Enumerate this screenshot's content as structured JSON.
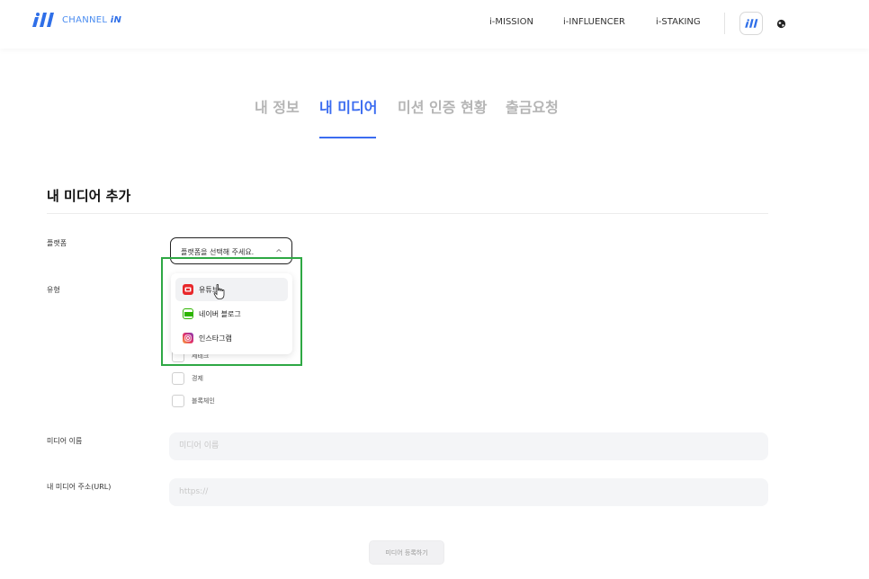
{
  "header": {
    "logo_text_prefix": "CHANNEL ",
    "logo_text_suffix": "iN",
    "nav": [
      "i-MISSION",
      "i-INFLUENCER",
      "i-STAKING"
    ],
    "wallet_icon": "logo-mark-icon",
    "globe_icon": "globe-icon"
  },
  "tabs": [
    {
      "label": "내 정보",
      "active": false
    },
    {
      "label": "내 미디어",
      "active": true
    },
    {
      "label": "미션 인증 현황",
      "active": false
    },
    {
      "label": "출금요청",
      "active": false
    }
  ],
  "section": {
    "title": "내 미디어 추가"
  },
  "form": {
    "platform_label": "플랫폼",
    "platform_placeholder": "플랫폼을 선택해 주세요.",
    "type_label": "유형",
    "type_options": [
      "세테크",
      "경제",
      "블록체인"
    ],
    "media_name_label": "미디어 이름",
    "media_name_placeholder": "미디어 이름",
    "url_label": "내 미디어 주소(URL)",
    "url_placeholder": "https://",
    "submit_label": "미디어 등록하기"
  },
  "dropdown": {
    "items": [
      {
        "label": "유튜브",
        "icon": "youtube-icon",
        "color": "#e8282b"
      },
      {
        "label": "네이버 블로그",
        "icon": "naver-blog-icon",
        "color": "#2db400"
      },
      {
        "label": "인스타그램",
        "icon": "instagram-icon",
        "color": "#d6249f"
      }
    ]
  },
  "colors": {
    "accent": "#3b6cf0",
    "highlight": "#2ea844"
  }
}
